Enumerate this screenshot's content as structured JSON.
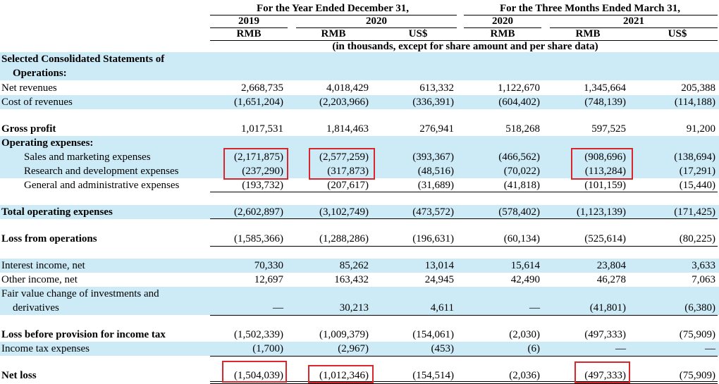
{
  "header": {
    "group_year": "For the Year Ended December 31,",
    "group_quarter": "For the Three Months Ended March 31,",
    "years": [
      "2019",
      "2020",
      "",
      "2020",
      "2021",
      ""
    ],
    "currencies": [
      "RMB",
      "RMB",
      "US$",
      "RMB",
      "RMB",
      "US$"
    ],
    "note": "(in thousands, except for share amount and per share data)"
  },
  "rows": {
    "section_title_1": "Selected Consolidated Statements of",
    "section_title_2": "Operations:",
    "net_revenues": {
      "label": "Net revenues",
      "values": [
        "2,668,735",
        "4,018,429",
        "613,332",
        "1,122,670",
        "1,345,664",
        "205,388"
      ]
    },
    "cost_of_revenues": {
      "label": "Cost of revenues",
      "values": [
        "(1,651,204)",
        "(2,203,966)",
        "(336,391)",
        "(604,402)",
        "(748,139)",
        "(114,188)"
      ]
    },
    "gross_profit": {
      "label": "Gross profit",
      "values": [
        "1,017,531",
        "1,814,463",
        "276,941",
        "518,268",
        "597,525",
        "91,200"
      ]
    },
    "operating_expenses": {
      "label": "Operating expenses:"
    },
    "sales_marketing": {
      "label": "Sales and marketing expenses",
      "values": [
        "(2,171,875)",
        "(2,577,259)",
        "(393,367)",
        "(466,562)",
        "(908,696)",
        "(138,694)"
      ]
    },
    "research_development": {
      "label": "Research and development expenses",
      "values": [
        "(237,290)",
        "(317,873)",
        "(48,516)",
        "(70,022)",
        "(113,284)",
        "(17,291)"
      ]
    },
    "general_admin": {
      "label": "General and administrative expenses",
      "values": [
        "(193,732)",
        "(207,617)",
        "(31,689)",
        "(41,818)",
        "(101,159)",
        "(15,440)"
      ]
    },
    "total_operating": {
      "label": "Total operating expenses",
      "values": [
        "(2,602,897)",
        "(3,102,749)",
        "(473,572)",
        "(578,402)",
        "(1,123,139)",
        "(171,425)"
      ]
    },
    "loss_operations": {
      "label": "Loss from operations",
      "values": [
        "(1,585,366)",
        "(1,288,286)",
        "(196,631)",
        "(60,134)",
        "(525,614)",
        "(80,225)"
      ]
    },
    "interest_income": {
      "label": "Interest income, net",
      "values": [
        "70,330",
        "85,262",
        "13,014",
        "15,614",
        "23,804",
        "3,633"
      ]
    },
    "other_income": {
      "label": "Other income, net",
      "values": [
        "12,697",
        "163,432",
        "24,945",
        "42,490",
        "46,278",
        "7,063"
      ]
    },
    "fair_value": {
      "label1": "Fair value change of investments and",
      "label2": "derivatives",
      "values": [
        "—",
        "30,213",
        "4,611",
        "—",
        "(41,801)",
        "(6,380)"
      ]
    },
    "loss_before_tax": {
      "label": "Loss before provision for income tax",
      "values": [
        "(1,502,339)",
        "(1,009,379)",
        "(154,061)",
        "(2,030)",
        "(497,333)",
        "(75,909)"
      ]
    },
    "income_tax": {
      "label": "Income tax expenses",
      "values": [
        "(1,700)",
        "(2,967)",
        "(453)",
        "(6)",
        "—",
        "—"
      ]
    },
    "net_loss": {
      "label": "Net loss",
      "values": [
        "(1,504,039)",
        "(1,012,346)",
        "(154,514)",
        "(2,036)",
        "(497,333)",
        "(75,909)"
      ]
    }
  },
  "colors": {
    "row_stripe": "#cdeaf7",
    "highlight_box": "#d9262c"
  }
}
